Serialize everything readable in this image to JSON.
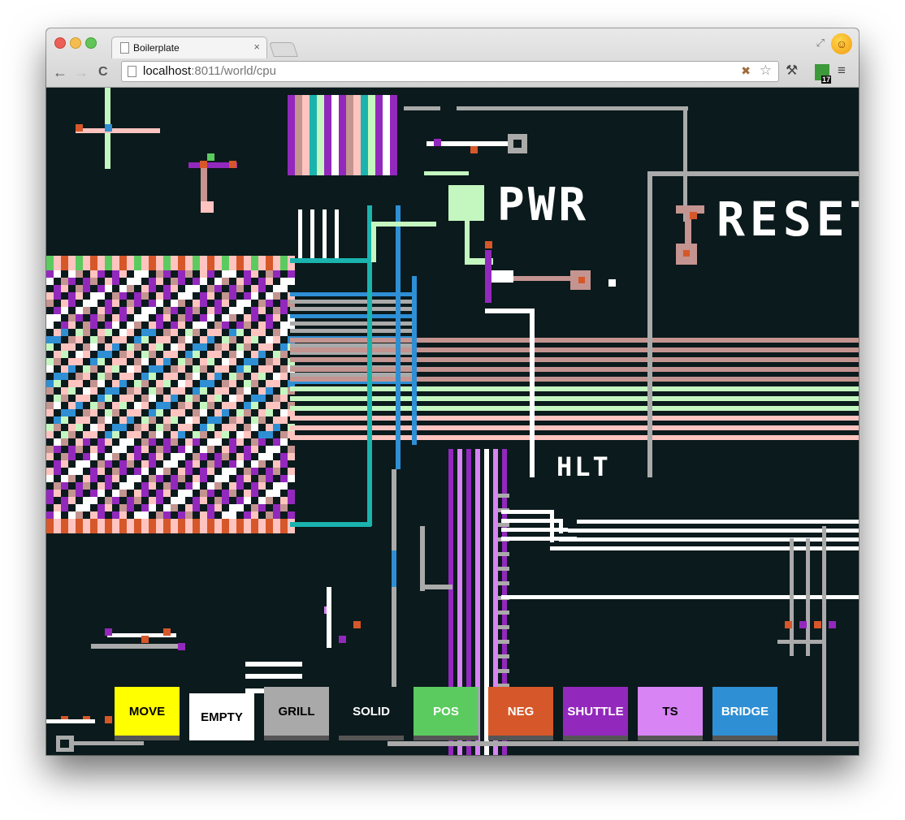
{
  "browser": {
    "tab_title": "Boilerplate",
    "tab_close": "×",
    "url_host": "localhost",
    "url_rest": ":8011/world/cpu",
    "extension_badge": "17",
    "back": "←",
    "forward": "→",
    "reload": "C",
    "bookmark": "☆",
    "menu": "≡",
    "wrench": "🔧"
  },
  "canvas_labels": {
    "pwr": "PWR",
    "reset": "RESET",
    "hlt": "HLT"
  },
  "palette": {
    "buttons": [
      {
        "label": "MOVE",
        "bg": "#ffff00",
        "fg": "#000000"
      },
      {
        "label": "EMPTY",
        "bg": "#ffffff",
        "fg": "#000000",
        "selected": true
      },
      {
        "label": "GRILL",
        "bg": "#a9a9a9",
        "fg": "#000000"
      },
      {
        "label": "SOLID",
        "bg": "#0b1a1c",
        "fg": "#ffffff"
      },
      {
        "label": "POS",
        "bg": "#5ccb5f",
        "fg": "#ffffff"
      },
      {
        "label": "NEG",
        "bg": "#d65729",
        "fg": "#ffffff"
      },
      {
        "label": "SHUTTLE",
        "bg": "#9328bd",
        "fg": "#ffffff"
      },
      {
        "label": "TS",
        "bg": "#d884f4",
        "fg": "#000000"
      },
      {
        "label": "BRIDGE",
        "bg": "#2e8fd4",
        "fg": "#ffffff"
      }
    ]
  },
  "colors": {
    "background": "#0b1a1c",
    "wire_white": "#ffffff",
    "wire_grey": "#aaaaaa",
    "pink": "#ffc4c0",
    "rose": "#c49490",
    "light_green": "#c4f7c0",
    "teal": "#1ab3ae",
    "blue": "#2e8fd4",
    "purple": "#9328bd",
    "violet": "#d884f4",
    "orange": "#d65729",
    "green": "#5ccb5f"
  }
}
